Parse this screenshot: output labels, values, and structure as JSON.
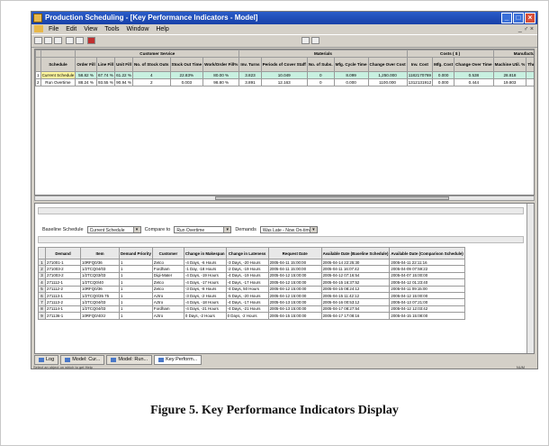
{
  "window": {
    "title": "Production Scheduling - [Key Performance Indicators - Model]",
    "min": "_",
    "max": "□",
    "close": "×"
  },
  "menu": {
    "items": [
      "File",
      "Edit",
      "View",
      "Tools",
      "Window",
      "Help"
    ],
    "right": "_ ♂ ×"
  },
  "grid": {
    "groups": [
      "Customer Service",
      "Materials",
      "Costs ( $ )",
      "Manufacturing"
    ],
    "headers": [
      "Schedule",
      "Order Fill",
      "Line Fill",
      "Unit Fill",
      "No. of Stock Outs",
      "Stock Out Time",
      "Work/Order Fill%",
      "Inv. Turns",
      "Periods of Cover Staff",
      "No. of Subs.",
      "Mfg. Cycle Time",
      "Change Over Cost",
      "Inv. Cost",
      "Mfg. Cost",
      "Change Over Time",
      "Machine Util. %",
      "Throughput Staff"
    ],
    "rows": [
      [
        "Current Schedule",
        "58.82 %",
        "67.74 %",
        "61.22 %",
        "4",
        "22.83%",
        "80.00 %",
        "3.823",
        "10.049",
        "0",
        "8.099",
        "1,250.000",
        "1182170769",
        "0.000",
        "0.538",
        "28.818",
        "840059.246"
      ],
      [
        "Run Overtime",
        "88.24 %",
        "93.55 %",
        "90.94 %",
        "2",
        "0.003",
        "98.80 %",
        "3.891",
        "12.163",
        "0",
        "0.000",
        "1100.000",
        "1312131912",
        "0.000",
        "0.444",
        "19.803",
        "891429.483"
      ]
    ]
  },
  "filters": {
    "baseline_label": "Baseline Schedule",
    "baseline_value": "Current Schedule",
    "compare_label": "Compare to",
    "compare_value": "Run Overtime",
    "demands_label": "Demands",
    "demands_value": "Was Late - Now On-time"
  },
  "detail": {
    "headers": [
      "Demand",
      "Item",
      "Demand Priority",
      "Customer",
      "Change in Makespan",
      "Change in Lateness",
      "Request Date",
      "Available Date (Baseline Schedule)",
      "Available Date (Comparison Schedule)"
    ],
    "rows": [
      [
        "1",
        "271001-1",
        "10RFQ0/36",
        "1",
        "Zetco",
        "-4 Days, -6 Hours",
        "-3 Days, -20 Hours",
        "2005-04-11 15:00:00",
        "2005-04-14 22:25:30",
        "2005-04-11 22:11:16"
      ],
      [
        "2",
        "271003-2",
        "1/2TCQ04/03",
        "1",
        "Fordham",
        "-1 Day, -18 Hours",
        "-2 Days, -19 Hours",
        "2005-04-11 15:00:00",
        "2005-04-11 16:07:42",
        "2005-04-09 07:59:22"
      ],
      [
        "3",
        "271003-2",
        "1/2TCQ03/03",
        "1",
        "Digi-Mater",
        "-4 Days, -19 Hours",
        "-4 Days, -19 Hours",
        "2005-04-12 15:00:00",
        "2005-04-12 07:16:54",
        "2005-04-07 15:00:00"
      ],
      [
        "4",
        "271112-1",
        "1/2TCQ0/40",
        "1",
        "Zetco",
        "-4 Days, -17 Hours",
        "-4 Days, -17 Hours",
        "2005-04-12 15:00:00",
        "2005-04-15 16:37:52",
        "2005-04-12 01:23:40"
      ],
      [
        "5",
        "271112-2",
        "10RFQ0/36",
        "1",
        "Zetco",
        "-3 Days, -8 Hours",
        "-4 Days, 50 Hours",
        "2005-04-12 15:00:00",
        "2005-04-15 08:24:12",
        "2005-04-11 09:15:00"
      ],
      [
        "6",
        "271113-1",
        "1/2TCQ0/35 75",
        "1",
        "Aztro",
        "-3 Days, -2 Hours",
        "-5 Days, -20 Hours",
        "2005-04-12 15:00:00",
        "2005-04-15 11:42:12",
        "2005-04-12 15:00:00"
      ],
      [
        "7",
        "271113-2",
        "1/2TCQ04/03",
        "1",
        "Aztro",
        "-4 Days, -18 Hours",
        "-4 Days, -17 Hours",
        "2005-04-13 15:00:00",
        "2005-04-16 00:53:12",
        "2005-04-13 07:21:00"
      ],
      [
        "8",
        "271114-1",
        "1/2TCQ04/03",
        "1",
        "Fordham",
        "-4 Days, -21 Hours",
        "-4 Days, -21 Hours",
        "2005-04-13 15:00:00",
        "2005-04-17 08:27:54",
        "2005-04-12 12:03:42"
      ],
      [
        "9",
        "271136-1",
        "10RFQ0/40/J",
        "1",
        "Aztro",
        "0 Days, -2 Hours",
        "0 Days, -2 Hours",
        "2005-04-15 15:00:00",
        "2005-04-17 17:08:16",
        "2005-04-15 15:08:00"
      ]
    ]
  },
  "tabs": [
    "Log",
    "Model: Cur...",
    "Model: Run...",
    "Key Perform..."
  ],
  "status": {
    "left": "Select an object on which to get Help",
    "right": "NUM"
  },
  "caption": "Figure 5.  Key Performance Indicators Display"
}
